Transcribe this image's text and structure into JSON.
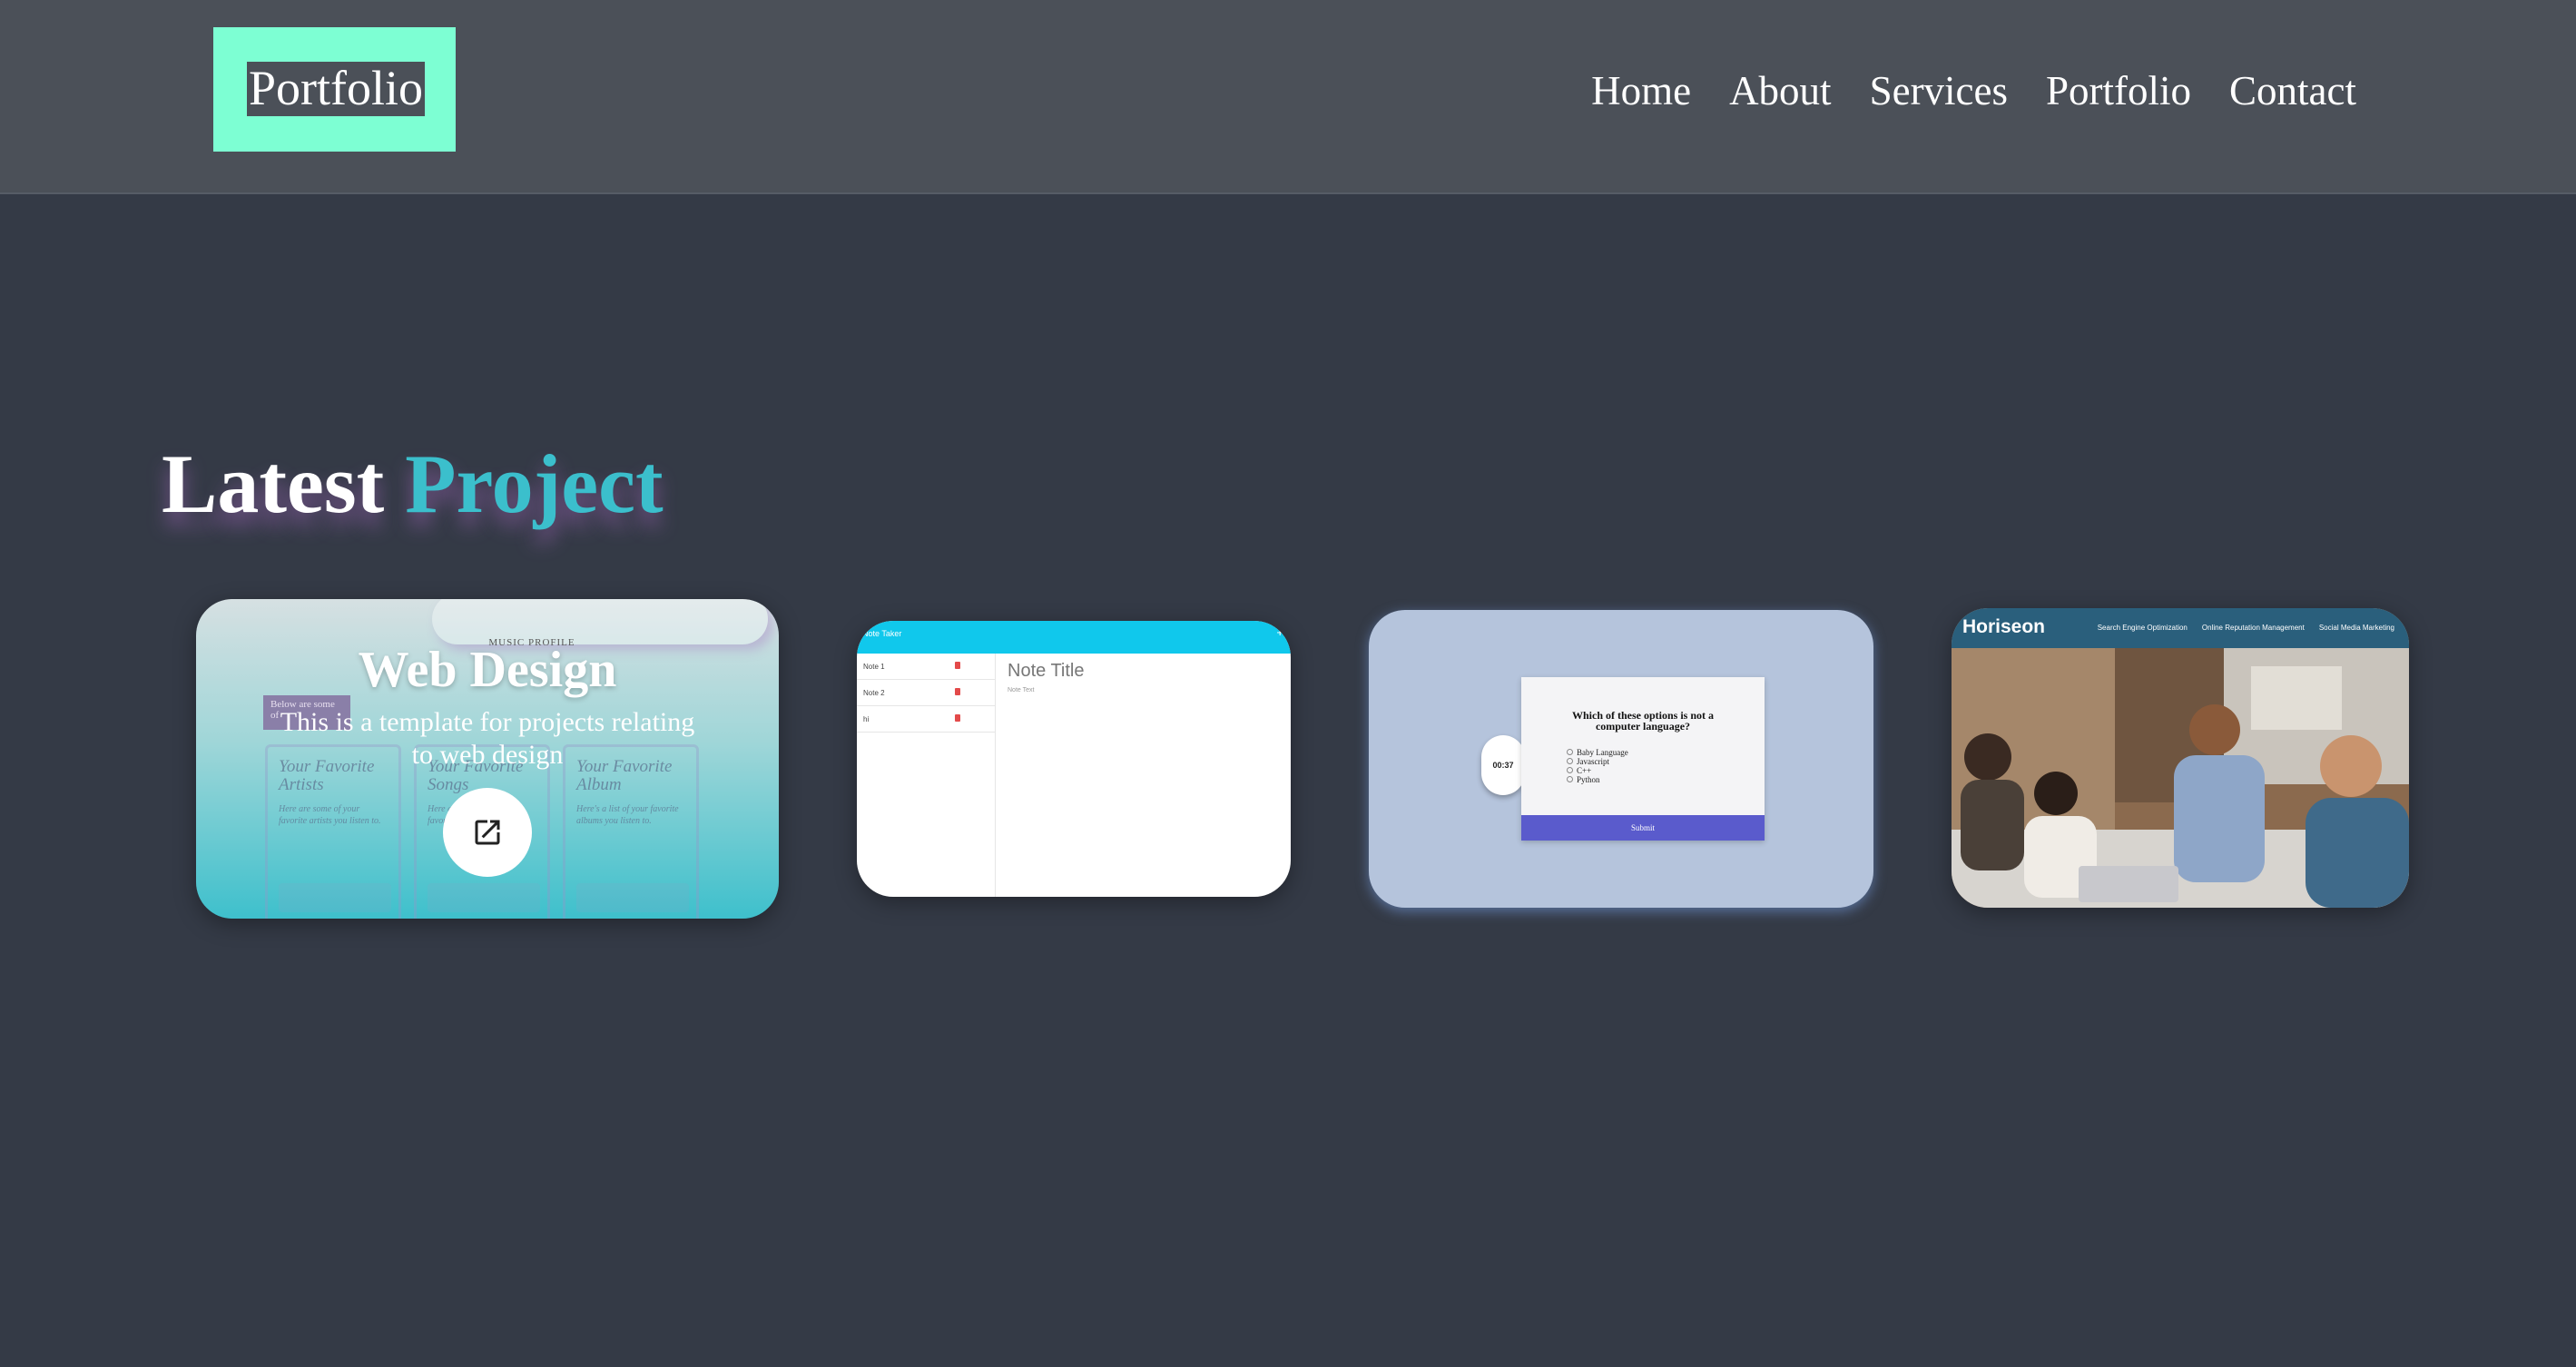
{
  "header": {
    "logo": "Portfolio",
    "nav": [
      {
        "label": "Home"
      },
      {
        "label": "About"
      },
      {
        "label": "Services"
      },
      {
        "label": "Portfolio"
      },
      {
        "label": "Contact"
      }
    ]
  },
  "section": {
    "title_part1": "Latest",
    "title_part2": "Project"
  },
  "projects": [
    {
      "title": "Web Design",
      "description": "This is a template for projects relating to web design",
      "launch_icon": "external-link-icon",
      "preview": {
        "heading": "MUSIC PROFILE",
        "tag": "Below are some of",
        "columns": [
          {
            "title": "Your Favorite Artists",
            "text": "Here are some of your favorite artists you listen to."
          },
          {
            "title": "Your Favorite Songs",
            "text": "Here are some of your favorite songs you listen to."
          },
          {
            "title": "Your Favorite Album",
            "text": "Here's a list of your favorite albums you listen to."
          }
        ]
      }
    },
    {
      "preview": {
        "brand": "Note Taker",
        "add": "+",
        "notes": [
          "Note 1",
          "Note 2",
          "hi"
        ],
        "note_title": "Note Title",
        "note_text": "Note Text"
      }
    },
    {
      "preview": {
        "timer": "00:37",
        "question": "Which of these options is not a computer language?",
        "options": [
          "Baby Language",
          "Javascript",
          "C++",
          "Python"
        ],
        "submit": "Submit"
      }
    },
    {
      "preview": {
        "logo": "Horiseon",
        "nav": [
          "Search Engine Optimization",
          "Online Reputation Management",
          "Social Media Marketing"
        ]
      }
    }
  ],
  "colors": {
    "background": "#343a46",
    "header": "#4b5058",
    "logo_box": "#7dffd3",
    "accent": "#3bbfcc"
  }
}
